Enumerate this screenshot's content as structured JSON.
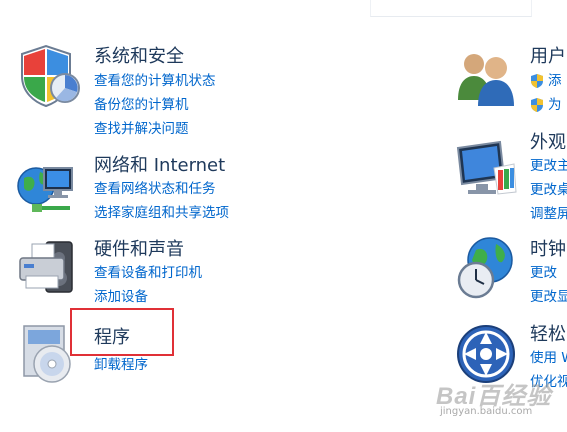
{
  "left_column": [
    {
      "icon": "system-security-shield-icon",
      "title": "系统和安全",
      "links": [
        "查看您的计算机状态",
        "备份您的计算机",
        "查找并解决问题"
      ]
    },
    {
      "icon": "network-internet-globe-icon",
      "title": "网络和 Internet",
      "links": [
        "查看网络状态和任务",
        "选择家庭组和共享选项"
      ]
    },
    {
      "icon": "hardware-sound-printer-icon",
      "title": "硬件和声音",
      "links": [
        "查看设备和打印机",
        "添加设备"
      ]
    },
    {
      "icon": "programs-disc-box-icon",
      "title": "程序",
      "links": [
        "卸载程序"
      ]
    }
  ],
  "right_column": [
    {
      "icon": "user-accounts-people-icon",
      "title": "用户",
      "links": [
        "添",
        "为"
      ]
    },
    {
      "icon": "appearance-monitor-icon",
      "title": "外观",
      "links": [
        "更改主",
        "更改桌",
        "调整屏"
      ]
    },
    {
      "icon": "clock-region-globe-icon",
      "title": "时钟",
      "links": [
        "更改",
        "更改显"
      ]
    },
    {
      "icon": "ease-of-access-icon",
      "title": "轻松",
      "links": [
        "使用 W",
        "优化视"
      ]
    }
  ],
  "highlight": {
    "color": "#e03036"
  },
  "watermark": {
    "logo": "Bai百经验",
    "url": "jingyan.baidu.com"
  },
  "colors": {
    "title": "#1e395b",
    "link": "#0066cc"
  }
}
